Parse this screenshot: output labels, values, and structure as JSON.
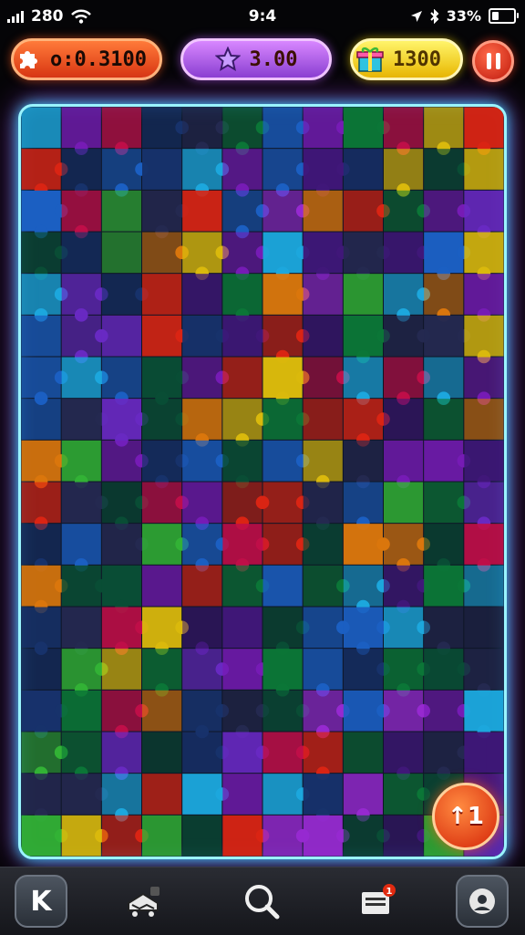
{
  "status_bar": {
    "signal_text": "280",
    "time": "9:4",
    "battery_text": "33%",
    "battery_level": 0.33
  },
  "hud": {
    "moves_value": "o:0.3100",
    "moves_icon": "puzzle-icon",
    "stars_value": "3.00",
    "stars_icon": "star-icon",
    "coins_value": "1300",
    "coins_icon": "gift-box-icon",
    "pause_icon": "pause-icon"
  },
  "board": {
    "cols": 12,
    "rows": 18,
    "frame_color": "#9af4ff",
    "glow_color": "#36d8ff",
    "palette": [
      "#7a2fe0",
      "#1f6fe0",
      "#0c8a3c",
      "#ff2a12",
      "#ff8a0a",
      "#ffd90a",
      "#8a1fd0",
      "#20c4ff",
      "#e01050",
      "#1a3a7a",
      "#2a2f5a",
      "#0a5a3a",
      "#b030f0",
      "#3ad13a",
      "#4a1a8a"
    ]
  },
  "hint_button": {
    "label": "↑1"
  },
  "nav": {
    "items": [
      {
        "icon": "k-logo-icon",
        "label": "K"
      },
      {
        "icon": "cart-icon",
        "label": ""
      },
      {
        "icon": "search-icon",
        "label": ""
      },
      {
        "icon": "inbox-icon",
        "label": ""
      },
      {
        "icon": "profile-icon",
        "label": ""
      }
    ],
    "inbox_badge": "1"
  }
}
